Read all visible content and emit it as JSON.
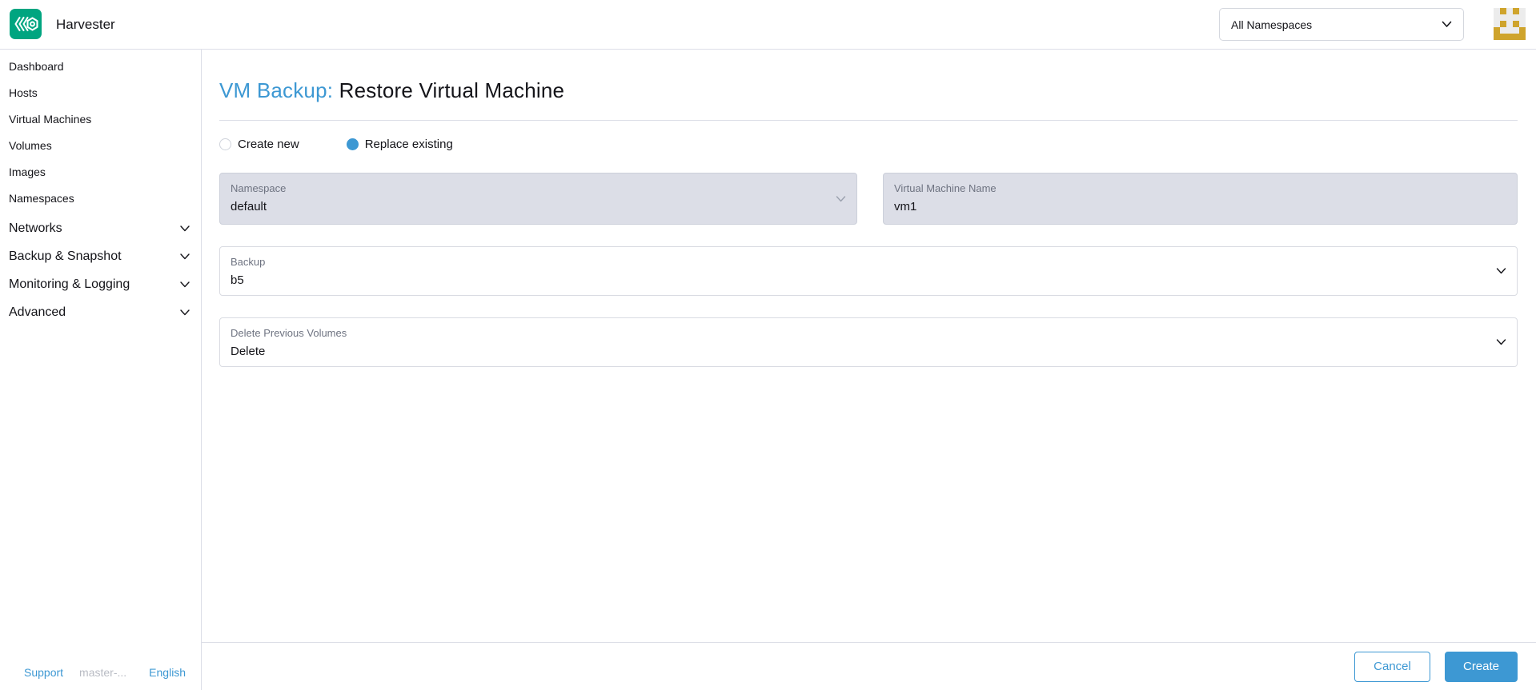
{
  "header": {
    "app_name": "Harvester",
    "namespace_filter": "All Namespaces",
    "avatar_pattern": [
      "01010",
      "00000",
      "01010",
      "10001",
      "11111"
    ]
  },
  "sidebar": {
    "items": [
      {
        "label": "Dashboard",
        "group": false
      },
      {
        "label": "Hosts",
        "group": false
      },
      {
        "label": "Virtual Machines",
        "group": false
      },
      {
        "label": "Volumes",
        "group": false
      },
      {
        "label": "Images",
        "group": false
      },
      {
        "label": "Namespaces",
        "group": false
      },
      {
        "label": "Networks",
        "group": true
      },
      {
        "label": "Backup & Snapshot",
        "group": true
      },
      {
        "label": "Monitoring & Logging",
        "group": true
      },
      {
        "label": "Advanced",
        "group": true
      }
    ]
  },
  "page": {
    "title_prefix": "VM Backup:",
    "title": "Restore Virtual Machine",
    "radios": [
      {
        "label": "Create new",
        "selected": false
      },
      {
        "label": "Replace existing",
        "selected": true
      }
    ],
    "fields": {
      "namespace": {
        "label": "Namespace",
        "value": "default"
      },
      "vm_name": {
        "label": "Virtual Machine Name",
        "value": "vm1"
      },
      "backup": {
        "label": "Backup",
        "value": "b5"
      },
      "delete_previous_volumes": {
        "label": "Delete Previous Volumes",
        "value": "Delete"
      }
    }
  },
  "footer": {
    "support_label": "Support",
    "version_label": "master-...",
    "language_label": "English",
    "cancel_label": "Cancel",
    "create_label": "Create"
  },
  "colors": {
    "primary": "#3d98d3",
    "logo_green": "#00a580",
    "avatar_gold": "#cfa42c",
    "avatar_light": "#ececec",
    "border": "#dcdee7",
    "disabled_bg": "#dcdee7",
    "text_dark": "#141419",
    "label_gray": "#6e7381"
  }
}
